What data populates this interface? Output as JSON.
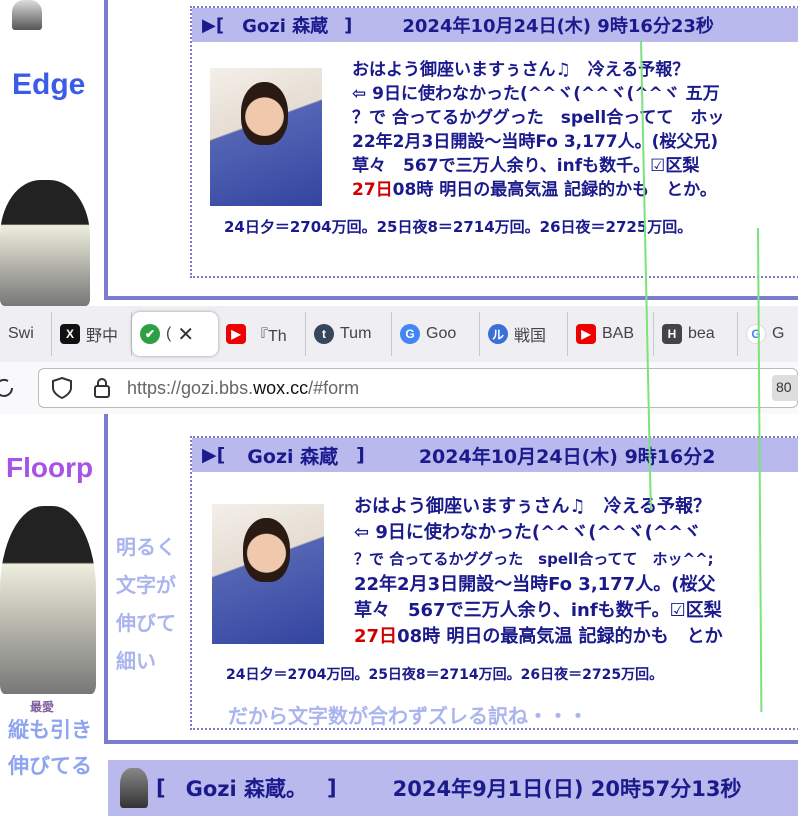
{
  "labels": {
    "edge": "Edge",
    "floorp": "Floorp",
    "saiai": "最愛",
    "note_left": [
      "縦も引き",
      "伸びてる"
    ],
    "note_mid": [
      "明るく",
      "文字が",
      "伸びて",
      "細い"
    ],
    "note_bottom": "だから文字数が合わずズレる訳ね・・・"
  },
  "post": {
    "marker": "▶[",
    "name": "Gozi 森蔵",
    "close": "]",
    "datetime_edge": "2024年10月24日(木) 9時16分23秒",
    "datetime_floorp": "2024年10月24日(木) 9時16分2",
    "lines_edge": [
      "おはよう御座いますぅさん♫　冷える予報？",
      "⇦ 9日に使わなかった(^^ヾ(^^ヾ(^^ヾ 五万",
      "？で 合ってるかググった　spell合ってて　ホッ",
      "22年2月3日開設〜当時Fo 3,177人。(桜父兄)",
      "草々　567で三万人余り、infも数千。☑区梨",
      "08時 明日の最高気温 記録的かも　とか。"
    ],
    "lines_floorp": [
      "おはよう御座いますぅさん♫　冷える予報？",
      "⇦ 9日に使わなかった(^^ヾ(^^ヾ(^^ヾ",
      "？で 合ってるかググった　spell合ってて　ホッ^^;",
      "22年2月3日開設〜当時Fo 3,177人。(桜父",
      "草々　567で三万人余り、infも数千。☑区梨",
      "08時 明日の最高気温 記録的かも　とか"
    ],
    "red_prefix": "27日",
    "stats": "24日夕＝2704万回。25日夜8＝2714万回。26日夜＝2725万回。"
  },
  "post2": {
    "marker": "[",
    "name": "Gozi 森蔵。",
    "close": "]",
    "datetime": "2024年9月1日(日) 20時57分13秒"
  },
  "browser": {
    "tabs": [
      {
        "icon": "",
        "label": "Swi"
      },
      {
        "icon": "X",
        "label": "野中"
      },
      {
        "icon": "✔",
        "label": "("
      },
      {
        "icon": "▶",
        "label": "『Th"
      },
      {
        "icon": "t",
        "label": "Tum"
      },
      {
        "icon": "G",
        "label": "Goo"
      },
      {
        "icon": "ル",
        "label": "戦国"
      },
      {
        "icon": "▶",
        "label": "BAB"
      },
      {
        "icon": "H",
        "label": "bea"
      },
      {
        "icon": "G",
        "label": "G"
      }
    ],
    "close_glyph": "✕",
    "url_prefix": "https://gozi.bbs.",
    "url_domain": "wox.cc",
    "url_suffix": "/#form",
    "zoom": "80"
  },
  "colors": {
    "accent": "#7b7bd0",
    "header_bg": "#b9b9ee",
    "text": "#1a1a8c",
    "label_blue": "#3b5ce6",
    "label_purple": "#a653e6",
    "guide_green": "#7de27d"
  }
}
